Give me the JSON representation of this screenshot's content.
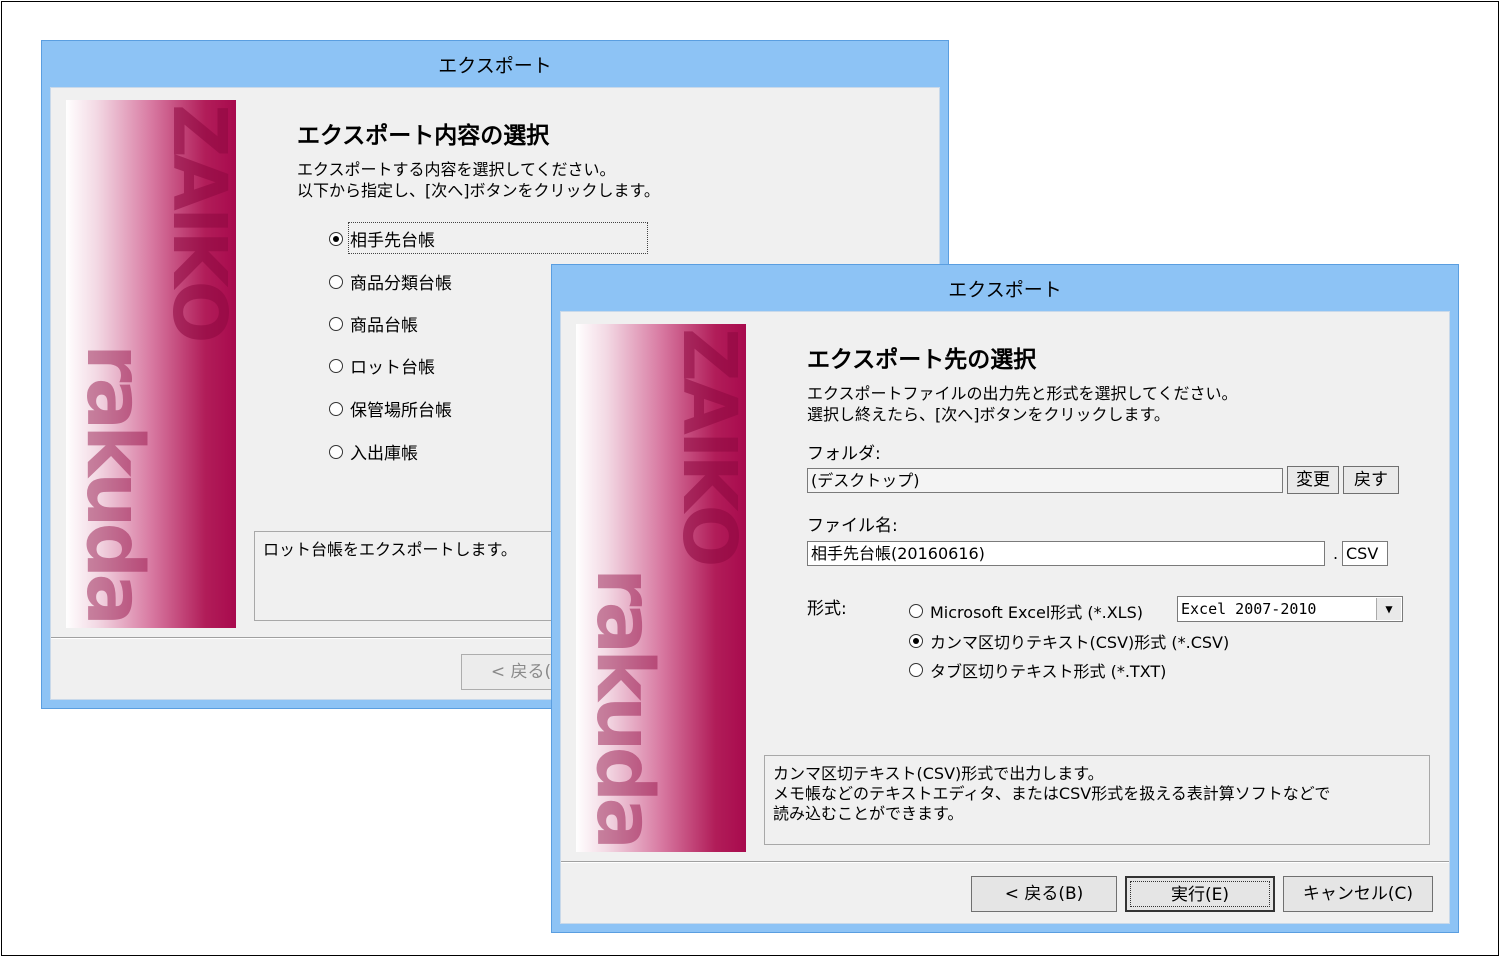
{
  "back_window": {
    "title": "エクスポート",
    "heading": "エクスポート内容の選択",
    "instruction_line1": "エクスポートする内容を選択してください。",
    "instruction_line2": "以下から指定し、[次へ]ボタンをクリックします。",
    "options": [
      {
        "label": "相手先台帳",
        "selected": true
      },
      {
        "label": "商品分類台帳",
        "selected": false
      },
      {
        "label": "商品台帳",
        "selected": false
      },
      {
        "label": "ロット台帳",
        "selected": false
      },
      {
        "label": "保管場所台帳",
        "selected": false
      },
      {
        "label": "入出庫帳",
        "selected": false
      }
    ],
    "description": "ロット台帳をエクスポートします。",
    "back_button": "< 戻る("
  },
  "front_window": {
    "title": "エクスポート",
    "heading": "エクスポート先の選択",
    "instruction_line1": "エクスポートファイルの出力先と形式を選択してください。",
    "instruction_line2": "選択し終えたら、[次へ]ボタンをクリックします。",
    "folder_label": "フォルダ:",
    "folder_value": "(デスクトップ)",
    "change_button": "変更",
    "revert_button": "戻す",
    "filename_label": "ファイル名:",
    "filename_value": "相手先台帳(20160616)",
    "extension_dot": ".",
    "extension_value": "CSV",
    "format_label": "形式:",
    "formats": [
      {
        "label": "Microsoft Excel形式 (*.XLS)",
        "selected": false
      },
      {
        "label": "カンマ区切りテキスト(CSV)形式 (*.CSV)",
        "selected": true
      },
      {
        "label": "タブ区切りテキスト形式 (*.TXT)",
        "selected": false
      }
    ],
    "excel_version": "Excel 2007-2010",
    "description_line1": "カンマ区切テキスト(CSV)形式で出力します。",
    "description_line2": "メモ帳などのテキストエディタ、またはCSV形式を扱える表計算ソフトなどで",
    "description_line3": "読み込むことができます。",
    "back_button": "< 戻る(B)",
    "execute_button": "実行(E)",
    "cancel_button": "キャンセル(C)"
  },
  "banner": {
    "logo_top": "ZAIKO",
    "logo_bottom": "rakuda",
    "colors": {
      "start": "#ffffff",
      "end": "#a80a4d"
    }
  },
  "icons": [
    "combo-arrow-icon",
    "radio-icon"
  ]
}
